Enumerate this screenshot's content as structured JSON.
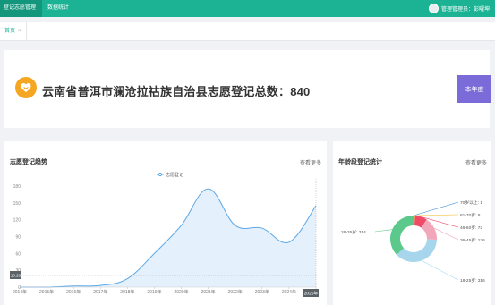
{
  "topbar": {
    "nav_items": [
      {
        "label": "登记志愿管理",
        "active": true
      },
      {
        "label": "数据统计",
        "active": false
      }
    ],
    "user_label": "管理管理员：彭曜坤"
  },
  "tabs": [
    {
      "label": "首页",
      "close": "×"
    }
  ],
  "summary": {
    "title": "云南省普洱市澜沧拉祜族自治县志愿登记总数：840",
    "button_label": "本年度"
  },
  "trend": {
    "title": "志愿登记趋势",
    "more_label": "查看更多",
    "chart_data": {
      "type": "area",
      "legend": [
        "志愿登记"
      ],
      "legend_placement": "top-center",
      "x": [
        "2014年",
        "2015年",
        "2016年",
        "2017年",
        "2018年",
        "2019年",
        "2020年",
        "2021年",
        "2022年",
        "2023年",
        "2024年",
        "2025年"
      ],
      "series": [
        {
          "name": "志愿登记",
          "values": [
            0,
            0,
            2,
            3,
            15,
            60,
            110,
            175,
            110,
            105,
            80,
            145
          ]
        }
      ],
      "ylim": [
        0,
        180
      ],
      "yticks": [
        0,
        30,
        60,
        90,
        120,
        150,
        180
      ],
      "grid": false,
      "pointer": {
        "x_label": "2025年",
        "y_label": "10.28"
      },
      "colors": {
        "line": "#5da8e6",
        "fill": "#e4f0fb",
        "tooltip": "#5a6268"
      }
    }
  },
  "age": {
    "title": "年龄段登记统计",
    "more_label": "查看更多",
    "chart_data": {
      "type": "pie",
      "style": "donut",
      "slices": [
        {
          "label": "70岁以上",
          "value": 1,
          "color": "#3b8fd9"
        },
        {
          "label": "61-70岁",
          "value": 8,
          "color": "#f5c34a"
        },
        {
          "label": "46-60岁",
          "value": 72,
          "color": "#ef4b67"
        },
        {
          "label": "36-45岁",
          "value": 136,
          "color": "#f2a6b9"
        },
        {
          "label": "18-25岁",
          "value": 316,
          "color": "#a6d5ec"
        },
        {
          "label": "26-35岁",
          "value": 314,
          "color": "#5cc98c"
        }
      ]
    }
  }
}
